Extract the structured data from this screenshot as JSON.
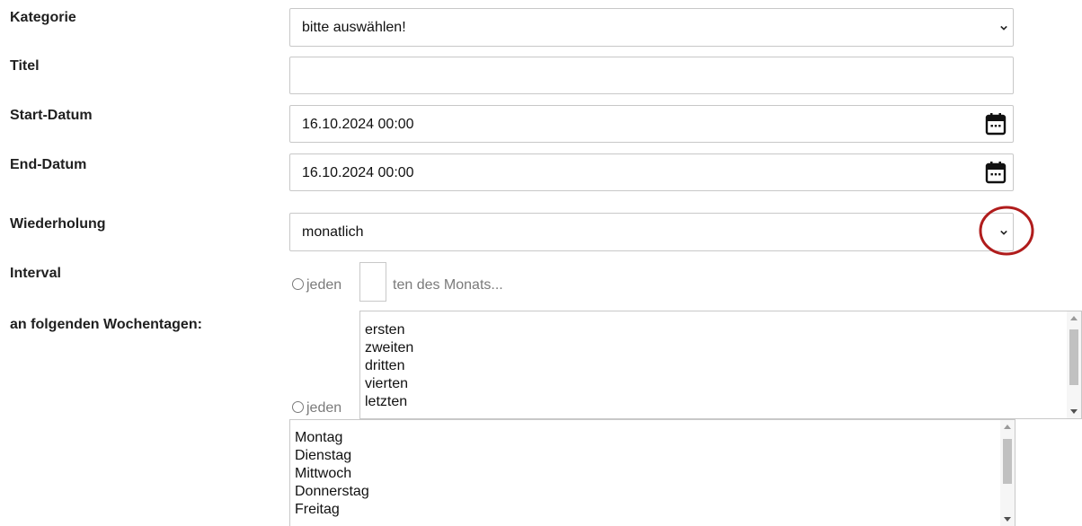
{
  "labels": {
    "kategorie": "Kategorie",
    "titel": "Titel",
    "start": "Start-Datum",
    "end": "End-Datum",
    "wiederholung": "Wiederholung",
    "interval": "Interval",
    "wochentage": "an folgenden Wochentagen:"
  },
  "kategorie": {
    "value": "bitte auswählen!"
  },
  "titel": {
    "value": ""
  },
  "start_datum": {
    "value": "16.10.2024 00:00"
  },
  "end_datum": {
    "value": "16.10.2024 00:00"
  },
  "wiederholung": {
    "value": "monatlich"
  },
  "interval": {
    "prefix": "jeden",
    "suffix": "ten des Monats...",
    "day_value": ""
  },
  "wochentage": {
    "prefix": "jeden",
    "ordinals": [
      "ersten",
      "zweiten",
      "dritten",
      "vierten",
      "letzten"
    ],
    "weekdays": [
      "Montag",
      "Dienstag",
      "Mittwoch",
      "Donnerstag",
      "Freitag"
    ]
  },
  "colors": {
    "highlight_circle": "#b01c1c",
    "border": "#c8c8c8",
    "radio_text": "#7a7a7a"
  },
  "icons": {
    "calendar": "calendar-icon",
    "dropdown": "chevron-down-icon"
  }
}
